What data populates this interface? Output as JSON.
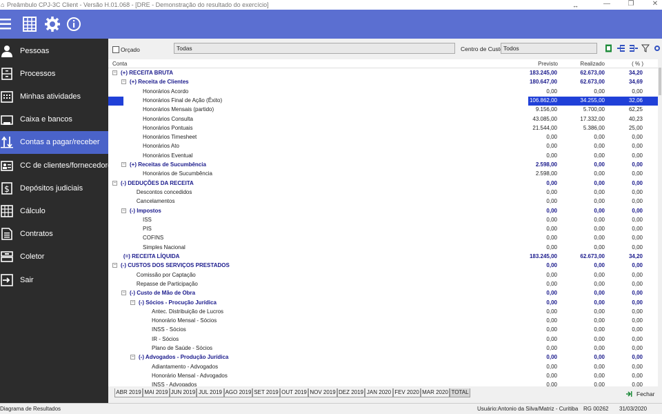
{
  "window": {
    "title": "Preâmbulo CPJ-3C Client - Versão H.01.068 - [DRE - Demonstração do resultado do exercício]"
  },
  "toolbar": {
    "icons": [
      "menu-icon",
      "spreadsheet-icon",
      "gear-icon",
      "info-icon"
    ]
  },
  "sidebar": {
    "items": [
      {
        "label": "Pessoas",
        "icon": "person-icon"
      },
      {
        "label": "Processos",
        "icon": "cabinet-icon"
      },
      {
        "label": "Minhas atividades",
        "icon": "calendar-icon"
      },
      {
        "label": "Caixa e bancos",
        "icon": "cashbox-icon"
      },
      {
        "label": "Contas a pagar/receber",
        "icon": "transfer-icon",
        "active": true
      },
      {
        "label": "CC de clientes/fornecedores",
        "icon": "id-card-icon"
      },
      {
        "label": "Depósitos judiciais",
        "icon": "dollar-icon"
      },
      {
        "label": "Cálculo",
        "icon": "grid-icon"
      },
      {
        "label": "Contratos",
        "icon": "document-icon"
      },
      {
        "label": "Coletor",
        "icon": "collector-icon"
      },
      {
        "label": "Sair",
        "icon": "exit-icon"
      }
    ]
  },
  "filters": {
    "orcado_label": "Orçado",
    "orcado_checked": false,
    "conta_value": "Todas",
    "centro_label": "Centro de Custo",
    "centro_value": "Todos"
  },
  "grid": {
    "headers": {
      "conta": "Conta",
      "previsto": "Previsto",
      "realizado": "Realizado",
      "pct": "( % )"
    },
    "rows": [
      {
        "level": 0,
        "toggle": "⊟",
        "label": "(+) RECEITA BRUTA",
        "bold": true,
        "previsto": "183.245,00",
        "realizado": "62.673,00",
        "pct": "34,20"
      },
      {
        "level": 1,
        "toggle": "⊟",
        "label": "(+) Receita de Clientes",
        "bold": true,
        "previsto": "180.647,00",
        "realizado": "62.673,00",
        "pct": "34,69"
      },
      {
        "level": 2,
        "label": "Honorários Acordo",
        "previsto": "0,00",
        "realizado": "0,00",
        "pct": "0,00"
      },
      {
        "level": 2,
        "label": "Honorários Final de Ação (Êxito)",
        "previsto": "106.862,00",
        "realizado": "34.255,00",
        "pct": "32,06",
        "selected": true
      },
      {
        "level": 2,
        "label": "Honorários Mensais (partido)",
        "previsto": "9.156,00",
        "realizado": "5.700,00",
        "pct": "62,25"
      },
      {
        "level": 2,
        "label": "Honorários Consulta",
        "previsto": "43.085,00",
        "realizado": "17.332,00",
        "pct": "40,23"
      },
      {
        "level": 2,
        "label": "Honorários Pontuais",
        "previsto": "21.544,00",
        "realizado": "5.386,00",
        "pct": "25,00"
      },
      {
        "level": 2,
        "label": "Honorários Timesheet",
        "previsto": "0,00",
        "realizado": "0,00",
        "pct": "0,00"
      },
      {
        "level": 2,
        "label": "Honorários Ato",
        "previsto": "0,00",
        "realizado": "0,00",
        "pct": "0,00"
      },
      {
        "level": 2,
        "label": "Honorários Eventual",
        "previsto": "0,00",
        "realizado": "0,00",
        "pct": "0,00"
      },
      {
        "level": 1,
        "toggle": "⊟",
        "label": "(+) Receitas de Sucumbência",
        "bold": true,
        "previsto": "2.598,00",
        "realizado": "0,00",
        "pct": "0,00"
      },
      {
        "level": 2,
        "label": "Honorários de Sucumbência",
        "previsto": "2.598,00",
        "realizado": "0,00",
        "pct": "0,00"
      },
      {
        "level": 0,
        "toggle": "⊟",
        "label": "(-) DEDUÇÕES DA RECEITA",
        "bold": true,
        "previsto": "0,00",
        "realizado": "0,00",
        "pct": "0,00"
      },
      {
        "level": 1.3,
        "label": "Descontos concedidos",
        "previsto": "0,00",
        "realizado": "0,00",
        "pct": "0,00"
      },
      {
        "level": 1.3,
        "label": "Cancelamentos",
        "previsto": "0,00",
        "realizado": "0,00",
        "pct": "0,00"
      },
      {
        "level": 1,
        "toggle": "⊟",
        "label": "(-) Impostos",
        "bold": true,
        "previsto": "0,00",
        "realizado": "0,00",
        "pct": "0,00"
      },
      {
        "level": 2,
        "label": "ISS",
        "previsto": "0,00",
        "realizado": "0,00",
        "pct": "0,00"
      },
      {
        "level": 2,
        "label": "PIS",
        "previsto": "0,00",
        "realizado": "0,00",
        "pct": "0,00"
      },
      {
        "level": 2,
        "label": "COFINS",
        "previsto": "0,00",
        "realizado": "0,00",
        "pct": "0,00"
      },
      {
        "level": 2,
        "label": "Simples Nacional",
        "previsto": "0,00",
        "realizado": "0,00",
        "pct": "0,00"
      },
      {
        "level": 0.3,
        "label": "(=) RECEITA LÍQUIDA",
        "bold": true,
        "previsto": "183.245,00",
        "realizado": "62.673,00",
        "pct": "34,20"
      },
      {
        "level": 0,
        "toggle": "⊟",
        "label": "(-) CUSTOS DOS SERVIÇOS PRESTADOS",
        "bold": true,
        "previsto": "0,00",
        "realizado": "0,00",
        "pct": "0,00"
      },
      {
        "level": 1.3,
        "label": "Comissão por Captação",
        "previsto": "0,00",
        "realizado": "0,00",
        "pct": "0,00"
      },
      {
        "level": 1.3,
        "label": "Repasse de Participação",
        "previsto": "0,00",
        "realizado": "0,00",
        "pct": "0,00"
      },
      {
        "level": 1,
        "toggle": "⊟",
        "label": "(-) Custo de Mão de Obra",
        "bold": true,
        "previsto": "0,00",
        "realizado": "0,00",
        "pct": "0,00"
      },
      {
        "level": 2,
        "toggle": "⊟",
        "label": "(-) Sócios - Procução Jurídica",
        "bold": true,
        "previsto": "0,00",
        "realizado": "0,00",
        "pct": "0,00"
      },
      {
        "level": 3,
        "label": "Antec. Distribuição de Lucros",
        "previsto": "0,00",
        "realizado": "0,00",
        "pct": "0,00"
      },
      {
        "level": 3,
        "label": "Honorário Mensal - Sócios",
        "previsto": "0,00",
        "realizado": "0,00",
        "pct": "0,00"
      },
      {
        "level": 3,
        "label": "INSS - Sócios",
        "previsto": "0,00",
        "realizado": "0,00",
        "pct": "0,00"
      },
      {
        "level": 3,
        "label": "IR - Sócios",
        "previsto": "0,00",
        "realizado": "0,00",
        "pct": "0,00"
      },
      {
        "level": 3,
        "label": "Plano de Saúde - Sócios",
        "previsto": "0,00",
        "realizado": "0,00",
        "pct": "0,00"
      },
      {
        "level": 2,
        "toggle": "⊟",
        "label": "(-) Advogados - Produção Jurídica",
        "bold": true,
        "previsto": "0,00",
        "realizado": "0,00",
        "pct": "0,00"
      },
      {
        "level": 3,
        "label": "Adiantamento - Advogados",
        "previsto": "0,00",
        "realizado": "0,00",
        "pct": "0,00"
      },
      {
        "level": 3,
        "label": "Honorário Mensal - Advogados",
        "previsto": "0,00",
        "realizado": "0,00",
        "pct": "0,00"
      },
      {
        "level": 3,
        "label": "INSS - Advogados",
        "previsto": "0,00",
        "realizado": "0,00",
        "pct": "0,00"
      }
    ]
  },
  "tabs": {
    "items": [
      "ABR 2019",
      "MAI 2019",
      "JUN 2019",
      "JUL 2019",
      "AGO 2019",
      "SET 2019",
      "OUT 2019",
      "NOV 2019",
      "DEZ 2019",
      "JAN 2020",
      "FEV 2020",
      "MAR 2020",
      "TOTAL"
    ],
    "active": "TOTAL",
    "fechar_label": "Fechar"
  },
  "status": {
    "left": "Diagrama de Resultados",
    "user": "Usuário:Antonio da Silva/Matriz - Curitiba",
    "rg": "RG 00262",
    "date": "31/03/2020"
  },
  "colors": {
    "toolbar": "#5b6fd1",
    "sidebar": "#2c2c2c",
    "sidebar_active": "#4a63c9",
    "group_text": "#1a1a8c",
    "selection": "#2040d8"
  }
}
